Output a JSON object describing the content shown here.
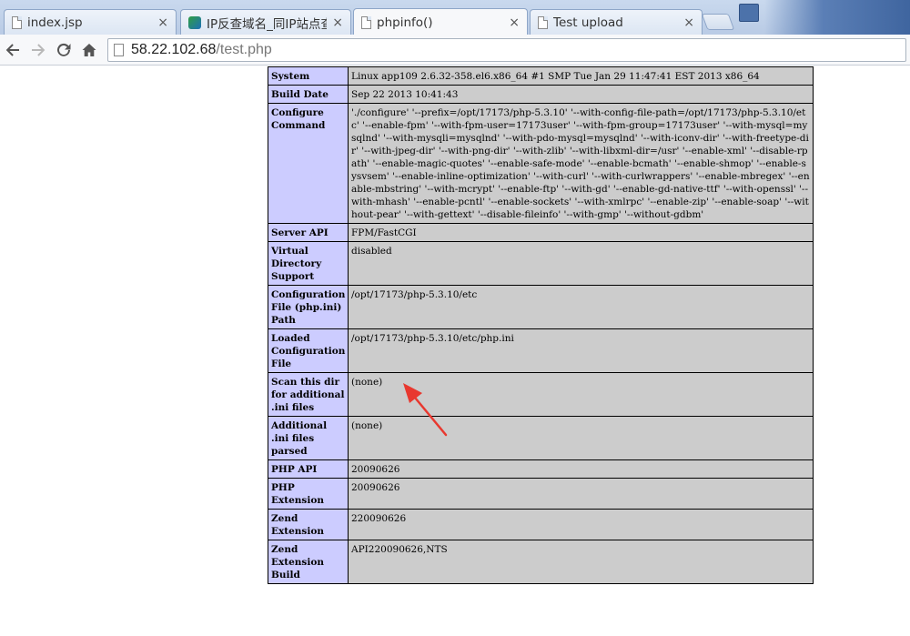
{
  "browser": {
    "tabs": [
      {
        "title": "index.jsp",
        "icon": "page-icon",
        "active": false
      },
      {
        "title": "IP反查域名_同IP站点查询",
        "icon": "site-favicon-icon",
        "active": false
      },
      {
        "title": "phpinfo()",
        "icon": "page-icon",
        "active": true
      },
      {
        "title": "Test upload",
        "icon": "page-icon",
        "active": false
      }
    ],
    "close_glyph": "×",
    "url_host": "58.22.102.68",
    "url_path": "/test.php"
  },
  "phpinfo": {
    "rows": [
      {
        "key": "System",
        "value": "Linux app109 2.6.32-358.el6.x86_64 #1 SMP Tue Jan 29 11:47:41 EST 2013 x86_64"
      },
      {
        "key": "Build Date",
        "value": "Sep 22 2013 10:41:43"
      },
      {
        "key": "Configure Command",
        "value": "'./configure' '--prefix=/opt/17173/php-5.3.10' '--with-config-file-path=/opt/17173/php-5.3.10/etc' '--enable-fpm' '--with-fpm-user=17173user' '--with-fpm-group=17173user' '--with-mysql=mysqlnd' '--with-mysqli=mysqlnd' '--with-pdo-mysql=mysqlnd' '--with-iconv-dir' '--with-freetype-dir' '--with-jpeg-dir' '--with-png-dir' '--with-zlib' '--with-libxml-dir=/usr' '--enable-xml' '--disable-rpath' '--enable-magic-quotes' '--enable-safe-mode' '--enable-bcmath' '--enable-shmop' '--enable-sysvsem' '--enable-inline-optimization' '--with-curl' '--with-curlwrappers' '--enable-mbregex' '--enable-mbstring' '--with-mcrypt' '--enable-ftp' '--with-gd' '--enable-gd-native-ttf' '--with-openssl' '--with-mhash' '--enable-pcntl' '--enable-sockets' '--with-xmlrpc' '--enable-zip' '--enable-soap' '--without-pear' '--with-gettext' '--disable-fileinfo' '--with-gmp' '--without-gdbm'"
      },
      {
        "key": "Server API",
        "value": "FPM/FastCGI"
      },
      {
        "key": "Virtual Directory Support",
        "value": "disabled"
      },
      {
        "key": "Configuration File (php.ini) Path",
        "value": "/opt/17173/php-5.3.10/etc"
      },
      {
        "key": "Loaded Configuration File",
        "value": "/opt/17173/php-5.3.10/etc/php.ini"
      },
      {
        "key": "Scan this dir for additional .ini files",
        "value": "(none)"
      },
      {
        "key": "Additional .ini files parsed",
        "value": "(none)"
      },
      {
        "key": "PHP API",
        "value": "20090626"
      },
      {
        "key": "PHP Extension",
        "value": "20090626"
      },
      {
        "key": "Zend Extension",
        "value": "220090626"
      },
      {
        "key": "Zend Extension Build",
        "value": "API220090626,NTS"
      }
    ]
  },
  "colors": {
    "key_cell": "#ccccff",
    "value_cell": "#cccccc",
    "annotation_arrow": "#e8382f"
  }
}
